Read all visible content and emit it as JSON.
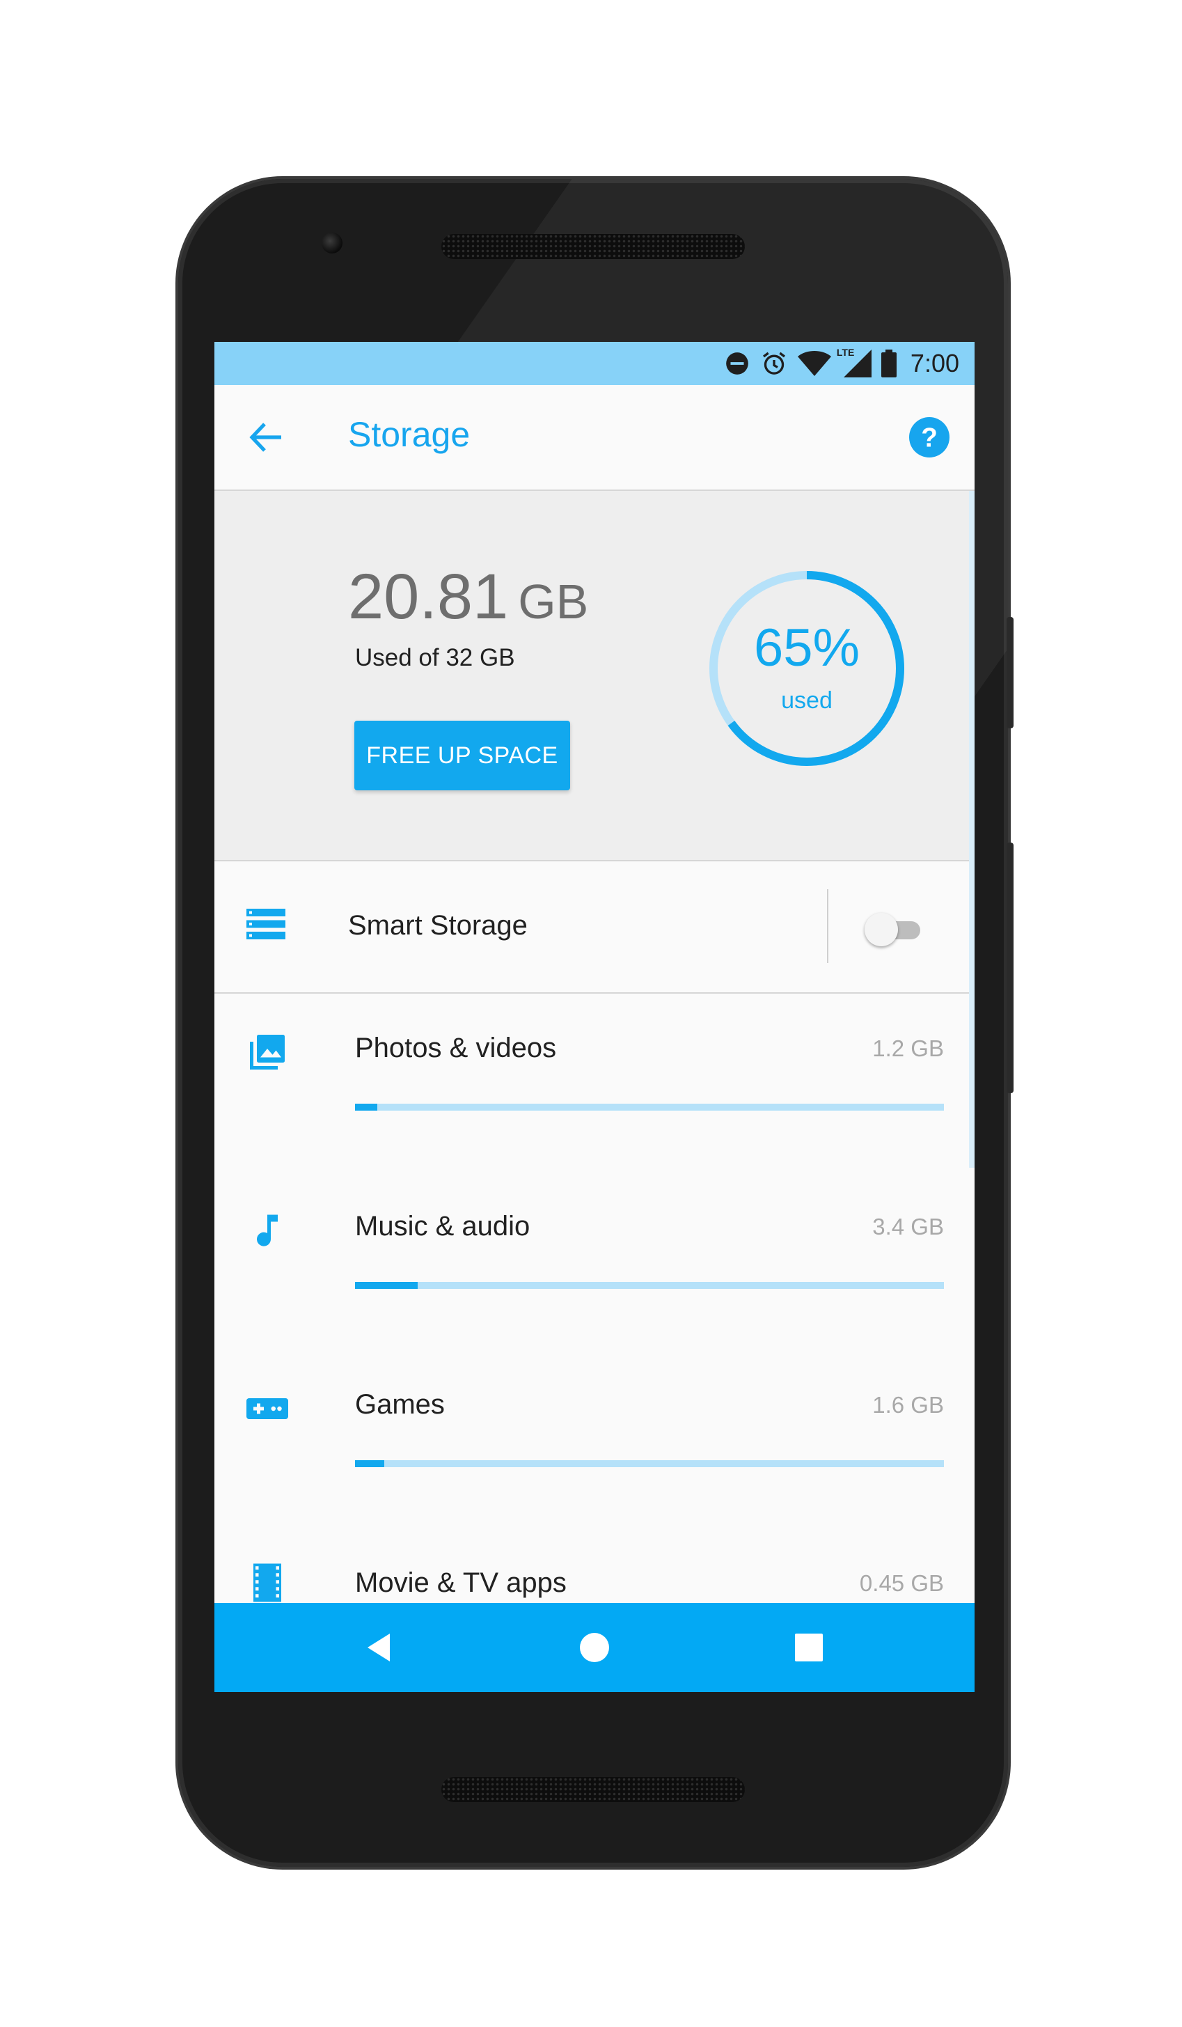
{
  "status_bar": {
    "time": "7:00",
    "network": "LTE",
    "icons": [
      "do-not-disturb-icon",
      "alarm-icon",
      "wifi-icon",
      "cell-signal-icon",
      "battery-icon"
    ]
  },
  "app_bar": {
    "title": "Storage",
    "back_icon": "arrow-back-icon",
    "help_icon": "help-icon"
  },
  "summary": {
    "used_value": "20.81",
    "used_unit": "GB",
    "used_of": "Used of 32 GB",
    "free_button_label": "FREE UP SPACE",
    "percent_text": "65%",
    "percent_label": "used",
    "percent_used": 0.65
  },
  "smart_storage": {
    "label": "Smart Storage",
    "icon": "storage-list-icon",
    "enabled": false
  },
  "categories": [
    {
      "label": "Photos & videos",
      "size": "1.2 GB",
      "icon": "photo-library-icon",
      "fraction": 0.0375
    },
    {
      "label": "Music & audio",
      "size": "3.4 GB",
      "icon": "music-note-icon",
      "fraction": 0.106
    },
    {
      "label": "Games",
      "size": "1.6 GB",
      "icon": "gamepad-icon",
      "fraction": 0.05
    },
    {
      "label": "Movie & TV apps",
      "size": "0.45 GB",
      "icon": "film-icon",
      "fraction": 0.014
    }
  ],
  "nav_bar": {
    "buttons": [
      "back-triangle-icon",
      "home-circle-icon",
      "recents-square-icon"
    ]
  },
  "colors": {
    "accent": "#12a8ee",
    "status_bar": "#87d2f8",
    "nav_bar": "#03a9f4",
    "bar_track": "#b5e1f9"
  }
}
